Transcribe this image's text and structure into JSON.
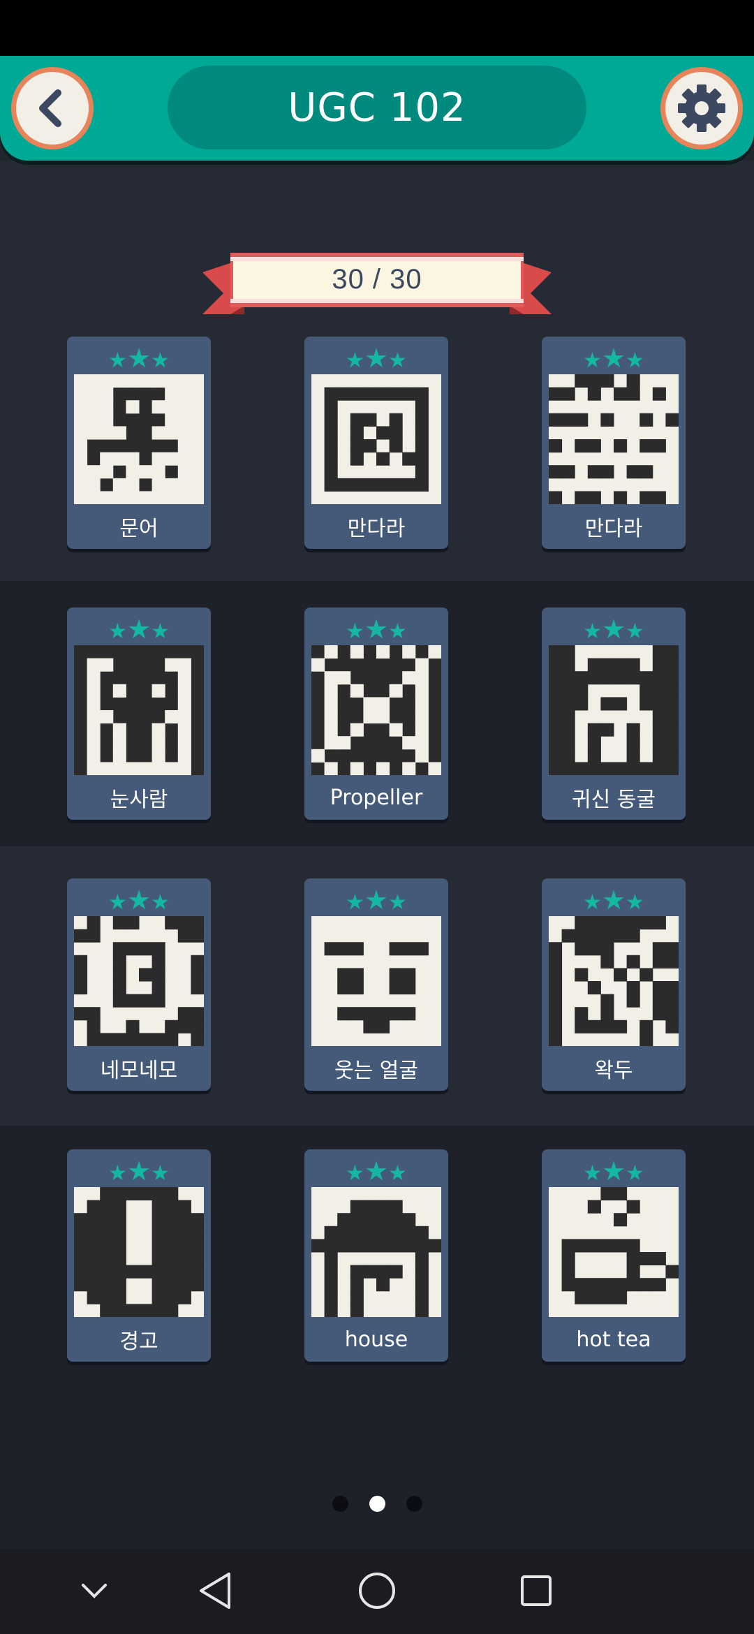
{
  "header": {
    "title": "UGC 102",
    "back_icon": "chevron-left-icon",
    "settings_icon": "gear-icon"
  },
  "progress": {
    "label": "30 / 30",
    "completed": 30,
    "total": 30
  },
  "colors": {
    "accent": "#00a896",
    "card": "#445a78",
    "star": "#14b8a0",
    "pixel_dark": "#2b2b2b",
    "pixel_light": "#f2efe6"
  },
  "puzzles": [
    {
      "label": "문어",
      "stars": 3
    },
    {
      "label": "만다라",
      "stars": 3
    },
    {
      "label": "만다라",
      "stars": 3
    },
    {
      "label": "눈사람",
      "stars": 3
    },
    {
      "label": "Propeller",
      "stars": 3
    },
    {
      "label": "귀신 동굴",
      "stars": 3
    },
    {
      "label": "네모네모",
      "stars": 3
    },
    {
      "label": "웃는 얼굴",
      "stars": 3
    },
    {
      "label": "왁두",
      "stars": 3
    },
    {
      "label": "경고",
      "stars": 3
    },
    {
      "label": "house",
      "stars": 3
    },
    {
      "label": "hot tea",
      "stars": 3
    }
  ],
  "pagination": {
    "pages": 3,
    "current": 2
  },
  "nav": {
    "icons": [
      "chevron-down-icon",
      "back-triangle-icon",
      "home-circle-icon",
      "recents-square-icon"
    ]
  }
}
